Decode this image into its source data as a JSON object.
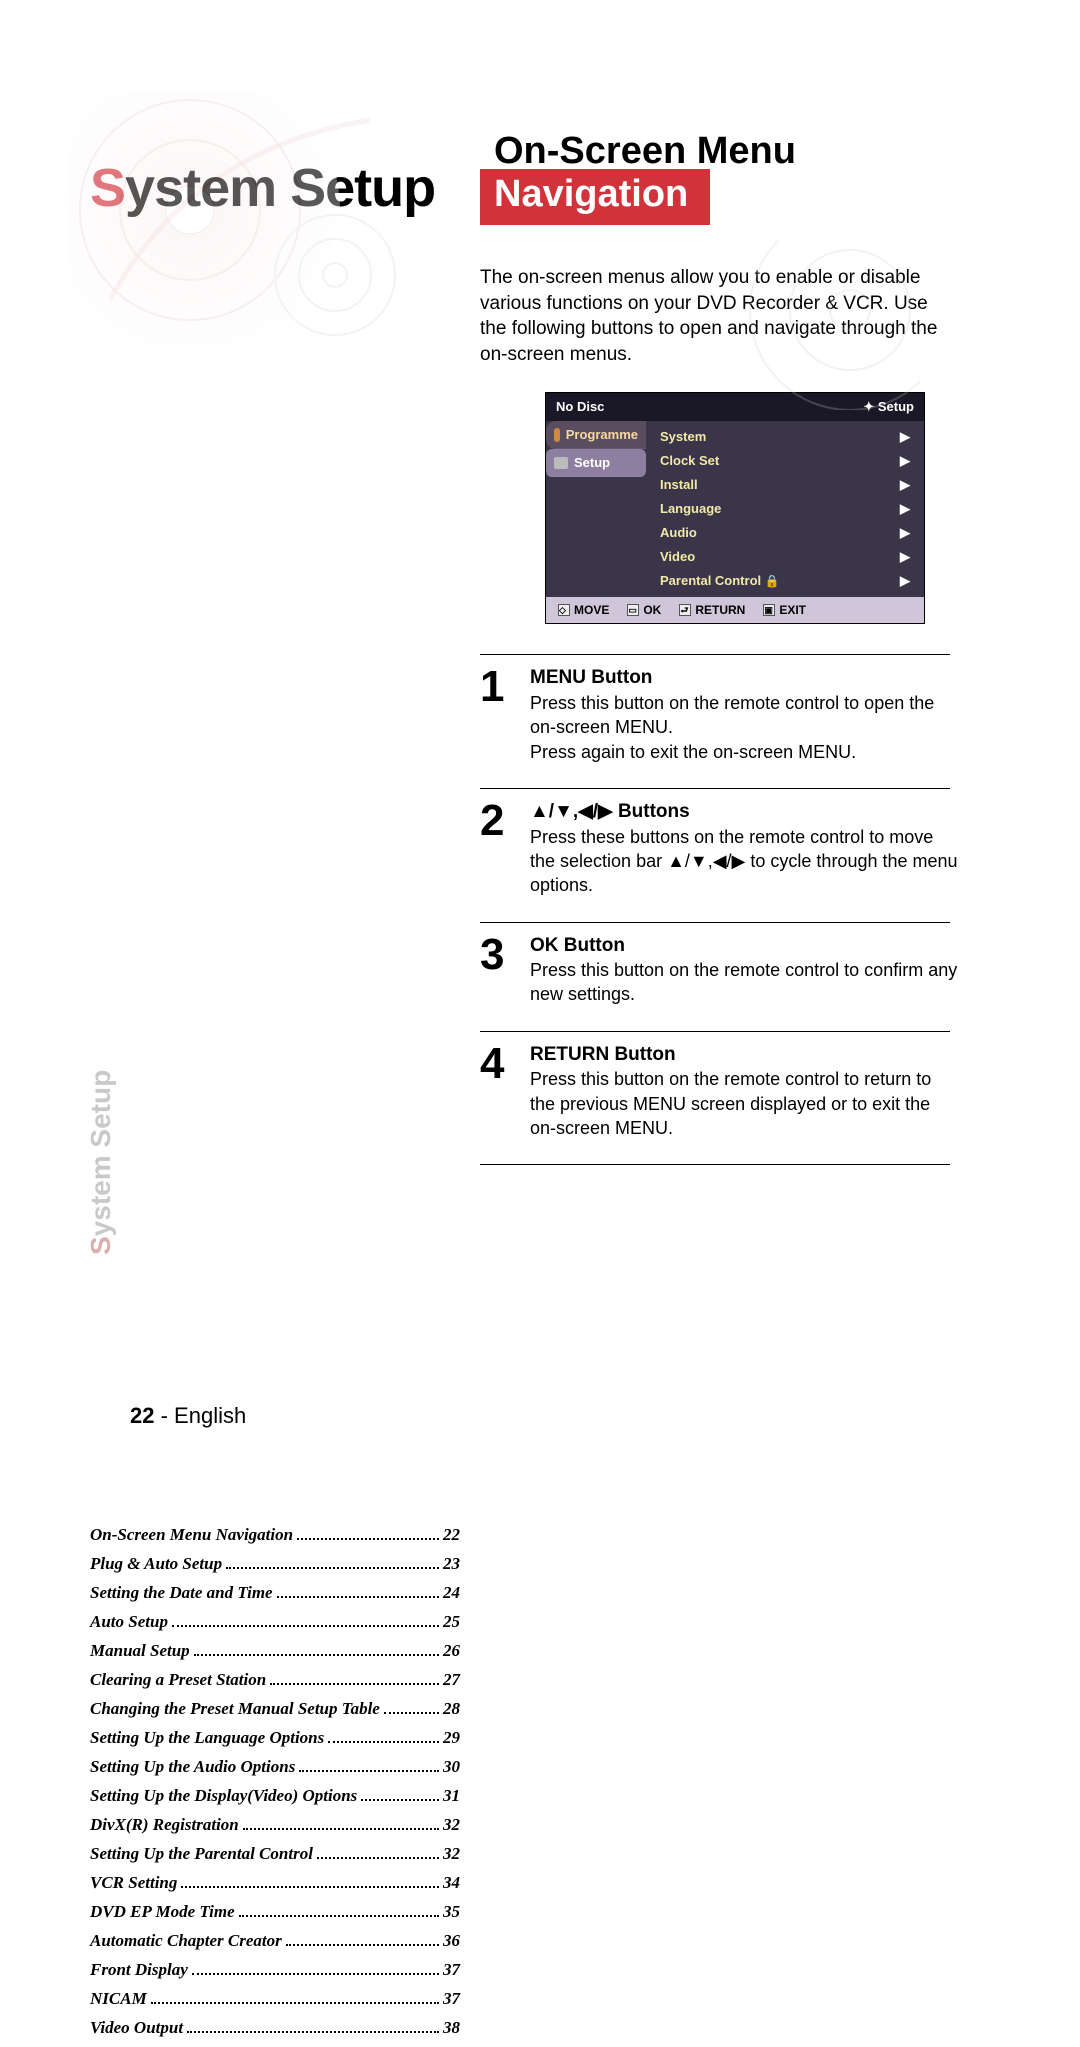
{
  "chapter": {
    "accent_letter": "S",
    "rest": "ystem Setup"
  },
  "side_label": {
    "accent_letter": "S",
    "rest": "ystem Setup"
  },
  "section": {
    "line1": "On-Screen Menu",
    "line2": "Navigation"
  },
  "intro": "The on-screen menus allow you to enable or disable various functions on your DVD Recorder & VCR. Use the following buttons to open and navigate through the on-screen menus.",
  "osd": {
    "top_left": "No Disc",
    "top_right": "Setup",
    "side": {
      "programme": "Programme",
      "setup": "Setup"
    },
    "items": [
      "System",
      "Clock Set",
      "Install",
      "Language",
      "Audio",
      "Video",
      "Parental Control"
    ],
    "bottom": {
      "move": "MOVE",
      "ok": "OK",
      "return": "RETURN",
      "exit": "EXIT"
    }
  },
  "steps": [
    {
      "num": "1",
      "title": "MENU Button",
      "body": "Press this button on the remote control to open the on-screen MENU.\nPress again to exit the on-screen MENU."
    },
    {
      "num": "2",
      "title_prefix": "▲/▼,◀/▶ ",
      "title": "Buttons",
      "body": "Press these buttons on the remote control to move the selection bar ▲/▼,◀/▶ to cycle through the menu options."
    },
    {
      "num": "3",
      "title": "OK Button",
      "body": "Press this button on the remote control to confirm any new settings."
    },
    {
      "num": "4",
      "title": "RETURN Button",
      "body": "Press this button on the remote control to return to the previous MENU screen displayed or to exit the on-screen MENU."
    }
  ],
  "toc": [
    {
      "t": "On-Screen Menu Navigation",
      "p": "22"
    },
    {
      "t": "Plug & Auto Setup",
      "p": "23"
    },
    {
      "t": "Setting the Date and Time",
      "p": "24"
    },
    {
      "t": "Auto Setup",
      "p": "25"
    },
    {
      "t": "Manual Setup",
      "p": "26"
    },
    {
      "t": "Clearing a Preset Station",
      "p": "27"
    },
    {
      "t": "Changing the Preset Manual Setup Table",
      "p": "28"
    },
    {
      "t": "Setting Up the Language Options",
      "p": "29"
    },
    {
      "t": "Setting Up the Audio Options",
      "p": "30"
    },
    {
      "t": "Setting Up the Display(Video) Options",
      "p": "31"
    },
    {
      "t": "DivX(R) Registration",
      "p": "32"
    },
    {
      "t": "Setting Up the Parental Control",
      "p": "32"
    },
    {
      "t": "VCR Setting",
      "p": "34"
    },
    {
      "t": "DVD EP Mode Time",
      "p": "35"
    },
    {
      "t": "Automatic Chapter Creator",
      "p": "36"
    },
    {
      "t": "Front Display",
      "p": "37"
    },
    {
      "t": "NICAM",
      "p": "37"
    },
    {
      "t": "Video Output",
      "p": "38"
    }
  ],
  "footer": {
    "page": "22",
    "sep": " - ",
    "lang": "English"
  }
}
